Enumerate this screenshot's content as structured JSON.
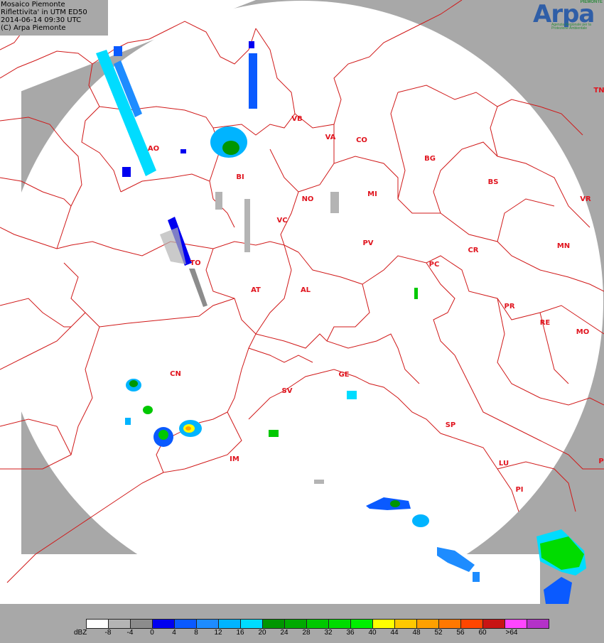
{
  "info": {
    "line1": "Mosaico Piemonte",
    "line2": "Riflettivita' in UTM ED50",
    "line3": "2014-06-14 09:30 UTC",
    "line4": "(C) Arpa Piemonte"
  },
  "logo": {
    "word": "Arpa",
    "tag": "PIEMONTE",
    "subtitle": "Agenzia Regionale per la Protezione Ambientale"
  },
  "legend": {
    "unit": "dBZ",
    "ticks": [
      "-8",
      "-4",
      "0",
      "4",
      "8",
      "12",
      "16",
      "20",
      "24",
      "28",
      "32",
      "36",
      "40",
      "44",
      "48",
      "52",
      "56",
      "60",
      ">64"
    ],
    "colors": [
      "#ffffff",
      "#b4b4b4",
      "#8c8c8c",
      "#0000f0",
      "#0a5aff",
      "#1e8cff",
      "#00b4ff",
      "#00dcff",
      "#009600",
      "#00aa00",
      "#00c800",
      "#00dc00",
      "#00f000",
      "#ffff00",
      "#ffc800",
      "#ffa000",
      "#ff7800",
      "#ff4600",
      "#c81414",
      "#ff46ff",
      "#b432c8"
    ]
  },
  "provinces": [
    {
      "id": "AO",
      "label": "AO"
    },
    {
      "id": "BI",
      "label": "BI"
    },
    {
      "id": "VB",
      "label": "VB"
    },
    {
      "id": "VA",
      "label": "VA"
    },
    {
      "id": "CO",
      "label": "CO"
    },
    {
      "id": "BG",
      "label": "BG"
    },
    {
      "id": "BS",
      "label": "BS"
    },
    {
      "id": "TN",
      "label": "TN"
    },
    {
      "id": "VR",
      "label": "VR"
    },
    {
      "id": "NO",
      "label": "NO"
    },
    {
      "id": "MI",
      "label": "MI"
    },
    {
      "id": "VC",
      "label": "VC"
    },
    {
      "id": "PV",
      "label": "PV"
    },
    {
      "id": "CR",
      "label": "CR"
    },
    {
      "id": "MN",
      "label": "MN"
    },
    {
      "id": "PC",
      "label": "PC"
    },
    {
      "id": "TO",
      "label": "TO"
    },
    {
      "id": "AT",
      "label": "AT"
    },
    {
      "id": "AL",
      "label": "AL"
    },
    {
      "id": "PR",
      "label": "PR"
    },
    {
      "id": "RE",
      "label": "RE"
    },
    {
      "id": "MO",
      "label": "MO"
    },
    {
      "id": "CN",
      "label": "CN"
    },
    {
      "id": "GE",
      "label": "GE"
    },
    {
      "id": "SV",
      "label": "SV"
    },
    {
      "id": "SP",
      "label": "SP"
    },
    {
      "id": "IM",
      "label": "IM"
    },
    {
      "id": "LU",
      "label": "LU"
    },
    {
      "id": "PI",
      "label": "PI"
    },
    {
      "id": "P",
      "label": "P"
    }
  ]
}
